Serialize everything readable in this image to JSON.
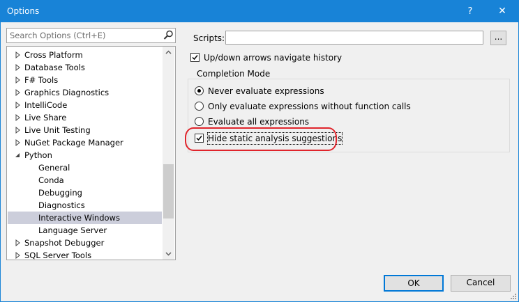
{
  "window": {
    "title": "Options",
    "help_glyph": "?",
    "close_glyph": "✕"
  },
  "search": {
    "placeholder": "Search Options (Ctrl+E)"
  },
  "tree": {
    "items": [
      {
        "label": "Cross Platform",
        "level": 0,
        "expandable": true
      },
      {
        "label": "Database Tools",
        "level": 0,
        "expandable": true
      },
      {
        "label": "F# Tools",
        "level": 0,
        "expandable": true
      },
      {
        "label": "Graphics Diagnostics",
        "level": 0,
        "expandable": true
      },
      {
        "label": "IntelliCode",
        "level": 0,
        "expandable": true
      },
      {
        "label": "Live Share",
        "level": 0,
        "expandable": true
      },
      {
        "label": "Live Unit Testing",
        "level": 0,
        "expandable": true
      },
      {
        "label": "NuGet Package Manager",
        "level": 0,
        "expandable": true
      },
      {
        "label": "Python",
        "level": 0,
        "expandable": true,
        "expanded": true
      },
      {
        "label": "General",
        "level": 1
      },
      {
        "label": "Conda",
        "level": 1
      },
      {
        "label": "Debugging",
        "level": 1
      },
      {
        "label": "Diagnostics",
        "level": 1
      },
      {
        "label": "Interactive Windows",
        "level": 1,
        "selected": true
      },
      {
        "label": "Language Server",
        "level": 1
      },
      {
        "label": "Snapshot Debugger",
        "level": 0,
        "expandable": true
      },
      {
        "label": "SQL Server Tools",
        "level": 0,
        "expandable": true
      }
    ]
  },
  "scripts": {
    "label": "Scripts:",
    "value": "",
    "browse_label": "..."
  },
  "updown": {
    "label": "Up/down arrows navigate history",
    "checked": true
  },
  "completion": {
    "title": "Completion Mode",
    "options": [
      {
        "label": "Never evaluate expressions",
        "selected": true
      },
      {
        "label": "Only evaluate expressions without function calls",
        "selected": false
      },
      {
        "label": "Evaluate all expressions",
        "selected": false
      }
    ]
  },
  "hide_static": {
    "label": "Hide static analysis suggestions",
    "checked": true
  },
  "buttons": {
    "ok": "OK",
    "cancel": "Cancel"
  },
  "colors": {
    "titlebar": "#1883d7",
    "selection": "#cccedb",
    "highlight_ring": "#e0242b",
    "default_button_border": "#0078d7"
  }
}
